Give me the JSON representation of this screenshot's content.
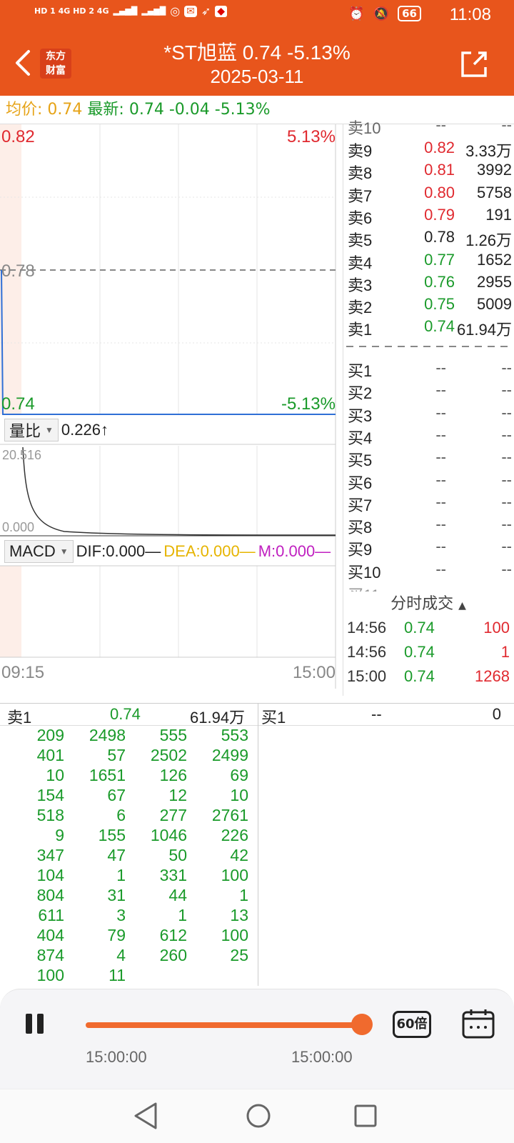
{
  "status": {
    "left_text": "HD 1 4G  HD 2 4G",
    "battery": "66",
    "time": "11:08"
  },
  "nav": {
    "title": "*ST旭蓝  0.74  -5.13%",
    "date": "2025-03-11",
    "logo_line1": "东方",
    "logo_line2": "财富"
  },
  "summary": {
    "avg_label": "均价:",
    "avg_value": "0.74",
    "latest_label": "最新:",
    "latest_price": "0.74",
    "change": "-0.04",
    "change_pct": "-5.13%"
  },
  "chart": {
    "price_high": "0.82",
    "price_mid": "0.78",
    "price_low": "0.74",
    "pct_high": "5.13%",
    "pct_low": "-5.13%",
    "time_start": "09:15",
    "time_end": "15:00"
  },
  "indicators": {
    "ratio_label": "量比",
    "ratio_value": "0.226↑",
    "ratio_max": "20.516",
    "ratio_min": "0.000",
    "macd_label": "MACD",
    "dif": "DIF:0.000—",
    "dea": "DEA:0.000—",
    "m": "M:0.000—"
  },
  "orderbook": {
    "sell_top_partial": "卖10",
    "sells": [
      {
        "label": "卖9",
        "price": "0.82",
        "vol": "3.33万",
        "color": "red"
      },
      {
        "label": "卖8",
        "price": "0.81",
        "vol": "3992",
        "color": "red"
      },
      {
        "label": "卖7",
        "price": "0.80",
        "vol": "5758",
        "color": "red"
      },
      {
        "label": "卖6",
        "price": "0.79",
        "vol": "191",
        "color": "red"
      },
      {
        "label": "卖5",
        "price": "0.78",
        "vol": "1.26万",
        "color": "black"
      },
      {
        "label": "卖4",
        "price": "0.77",
        "vol": "1652",
        "color": "green"
      },
      {
        "label": "卖3",
        "price": "0.76",
        "vol": "2955",
        "color": "green"
      },
      {
        "label": "卖2",
        "price": "0.75",
        "vol": "5009",
        "color": "green"
      },
      {
        "label": "卖1",
        "price": "0.74",
        "vol": "61.94万",
        "color": "green"
      }
    ],
    "buys": [
      {
        "label": "买1",
        "price": "--",
        "vol": "--"
      },
      {
        "label": "买2",
        "price": "--",
        "vol": "--"
      },
      {
        "label": "买3",
        "price": "--",
        "vol": "--"
      },
      {
        "label": "买4",
        "price": "--",
        "vol": "--"
      },
      {
        "label": "买5",
        "price": "--",
        "vol": "--"
      },
      {
        "label": "买6",
        "price": "--",
        "vol": "--"
      },
      {
        "label": "买7",
        "price": "--",
        "vol": "--"
      },
      {
        "label": "买8",
        "price": "--",
        "vol": "--"
      },
      {
        "label": "买9",
        "price": "--",
        "vol": "--"
      },
      {
        "label": "买10",
        "price": "--",
        "vol": "--"
      }
    ]
  },
  "ticks": {
    "header": "分时成交",
    "rows": [
      {
        "time": "14:56",
        "price": "0.74",
        "vol": "100"
      },
      {
        "time": "14:56",
        "price": "0.74",
        "vol": "1"
      },
      {
        "time": "15:00",
        "price": "0.74",
        "vol": "1268"
      }
    ]
  },
  "detail": {
    "sell_label": "卖1",
    "sell_price": "0.74",
    "sell_vol": "61.94万",
    "buy_label": "买1",
    "buy_price": "--",
    "buy_vol": "0",
    "queue": [
      [
        "209",
        "2498",
        "555",
        "553"
      ],
      [
        "401",
        "57",
        "2502",
        "2499"
      ],
      [
        "10",
        "1651",
        "126",
        "69"
      ],
      [
        "154",
        "67",
        "12",
        "10"
      ],
      [
        "518",
        "6",
        "277",
        "2761"
      ],
      [
        "9",
        "155",
        "1046",
        "226"
      ],
      [
        "347",
        "47",
        "50",
        "42"
      ],
      [
        "104",
        "1",
        "331",
        "100"
      ],
      [
        "804",
        "31",
        "44",
        "1"
      ],
      [
        "611",
        "3",
        "1",
        "13"
      ],
      [
        "404",
        "79",
        "612",
        "100"
      ],
      [
        "874",
        "4",
        "260",
        "25"
      ],
      [
        "100",
        "11",
        "",
        ""
      ]
    ]
  },
  "playback": {
    "time_start": "15:00:00",
    "time_end": "15:00:00",
    "speed": "60倍",
    "progress": 1.0
  },
  "colors": {
    "brand": "#e8551c",
    "up": "#e0292f",
    "down": "#1a9a2a",
    "avg": "#e6a317"
  }
}
